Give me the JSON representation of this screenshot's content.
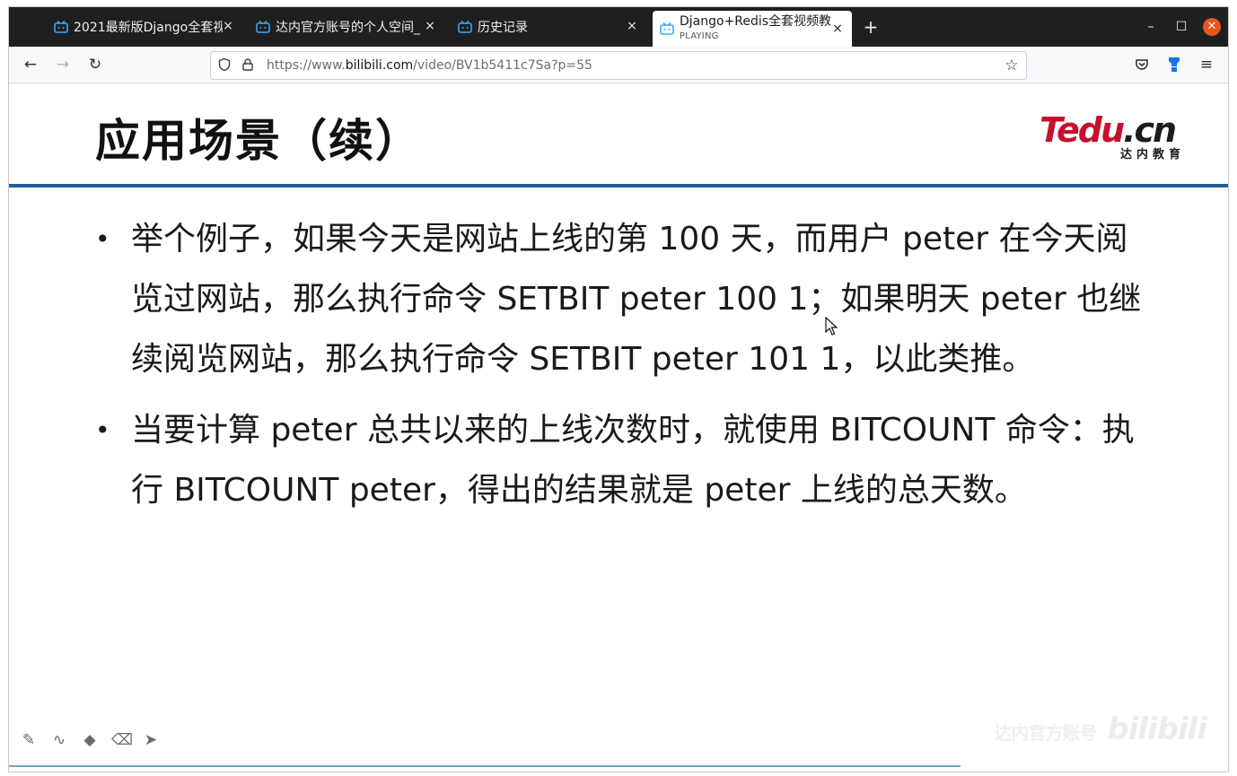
{
  "tabs": [
    {
      "title": "2021最新版Django全套视",
      "icon": "bilibili-tv-icon",
      "active": false
    },
    {
      "title": "达内官方账号的个人空间_",
      "icon": "bilibili-tv-icon",
      "active": false
    },
    {
      "title": "历史记录",
      "icon": "bilibili-tv-icon",
      "active": false
    },
    {
      "title": "Django+Redis全套视频教",
      "subtitle": "PLAYING",
      "icon": "bilibili-tv-icon",
      "active": true
    }
  ],
  "window": {
    "minimize": "–",
    "maximize": "☐",
    "close": "✕"
  },
  "nav": {
    "url_prefix": "https://www.",
    "url_domain": "bilibili.com",
    "url_path": "/video/BV1b5411c7Sa?p=55"
  },
  "slide": {
    "title": "应用场景（续）",
    "logo_main_te": "Te",
    "logo_main_du": "du",
    "logo_main_cn": ".cn",
    "logo_sub": "达内教育",
    "bullets": [
      "举个例子，如果今天是网站上线的第 100 天，而用户 peter 在今天阅览过网站，那么执行命令 SETBIT peter 100 1；如果明天 peter 也继续阅览网站，那么执行命令 SETBIT peter 101 1，以此类推。",
      "当要计算 peter 总共以来的上线次数时，就使用 BITCOUNT 命令：执行 BITCOUNT peter，得出的结果就是 peter 上线的总天数。"
    ]
  },
  "watermark": {
    "text": "达内官方账号",
    "brand": "bilibili"
  },
  "colors": {
    "accent_rule": "#1f5f99",
    "logo_red": "#c8102e",
    "close_orange": "#e95420"
  }
}
